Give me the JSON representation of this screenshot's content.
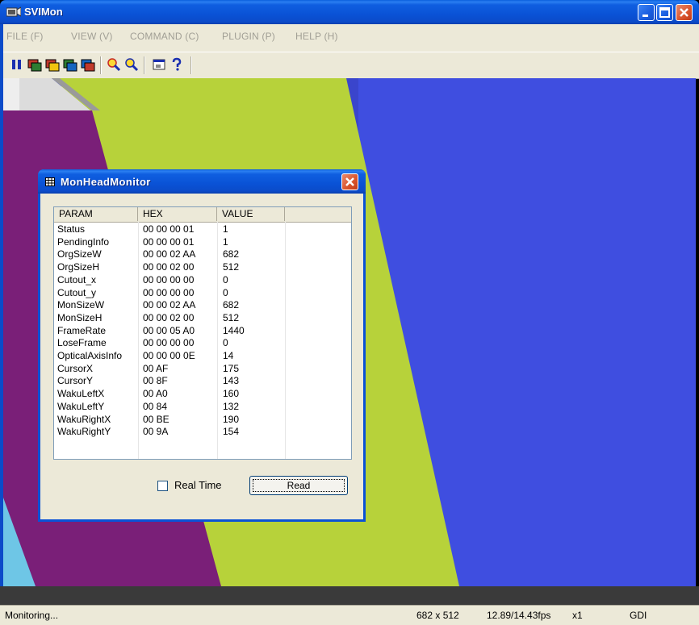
{
  "window": {
    "title": "SVIMon",
    "icon": "camera-icon"
  },
  "menu": [
    {
      "label": "FILE (F)"
    },
    {
      "label": "VIEW (V)"
    },
    {
      "label": "COMMAND (C)"
    },
    {
      "label": "PLUGIN (P)"
    },
    {
      "label": "HELP (H)"
    }
  ],
  "toolbar": {
    "icons": [
      "pause-icon",
      "video-record-icon",
      "video-play-icon",
      "video-capture-icon",
      "video-save-icon",
      "zoom-in-icon",
      "zoom-out-icon",
      "properties-icon",
      "help-icon"
    ]
  },
  "dialog": {
    "title": "MonHeadMonitor",
    "columns": [
      "PARAM",
      "HEX",
      "VALUE"
    ],
    "rows": [
      {
        "param": "Status",
        "hex": "00 00 00 01",
        "value": "1"
      },
      {
        "param": "PendingInfo",
        "hex": "00 00 00 01",
        "value": "1"
      },
      {
        "param": "OrgSizeW",
        "hex": "00 00 02 AA",
        "value": "682"
      },
      {
        "param": "OrgSizeH",
        "hex": "00 00 02 00",
        "value": "512"
      },
      {
        "param": "Cutout_x",
        "hex": "00 00 00 00",
        "value": "0"
      },
      {
        "param": "Cutout_y",
        "hex": "00 00 00 00",
        "value": "0"
      },
      {
        "param": "MonSizeW",
        "hex": "00 00 02 AA",
        "value": "682"
      },
      {
        "param": "MonSizeH",
        "hex": "00 00 02 00",
        "value": "512"
      },
      {
        "param": "FrameRate",
        "hex": "00 00 05 A0",
        "value": "1440"
      },
      {
        "param": "LoseFrame",
        "hex": "00 00 00 00",
        "value": "0"
      },
      {
        "param": "OpticalAxisInfo",
        "hex": "00 00 00 0E",
        "value": "14"
      },
      {
        "param": "CursorX",
        "hex": "00 AF",
        "value": "175"
      },
      {
        "param": "CursorY",
        "hex": "00 8F",
        "value": "143"
      },
      {
        "param": "WakuLeftX",
        "hex": "00 A0",
        "value": "160"
      },
      {
        "param": "WakuLeftY",
        "hex": "00 84",
        "value": "132"
      },
      {
        "param": "WakuRightX",
        "hex": "00 BE",
        "value": "190"
      },
      {
        "param": "WakuRightY",
        "hex": "00 9A",
        "value": "154"
      }
    ],
    "realtime_label": "Real Time",
    "realtime_checked": false,
    "read_label": "Read"
  },
  "status": {
    "text": "Monitoring...",
    "size": "682 x 512",
    "fps": "12.89/14.43fps",
    "zoom": "x1",
    "renderer": "GDI"
  },
  "colors": {
    "title_blue": "#0a52d6",
    "dialog_bg": "#ece9d8",
    "close_red": "#d9542c"
  }
}
